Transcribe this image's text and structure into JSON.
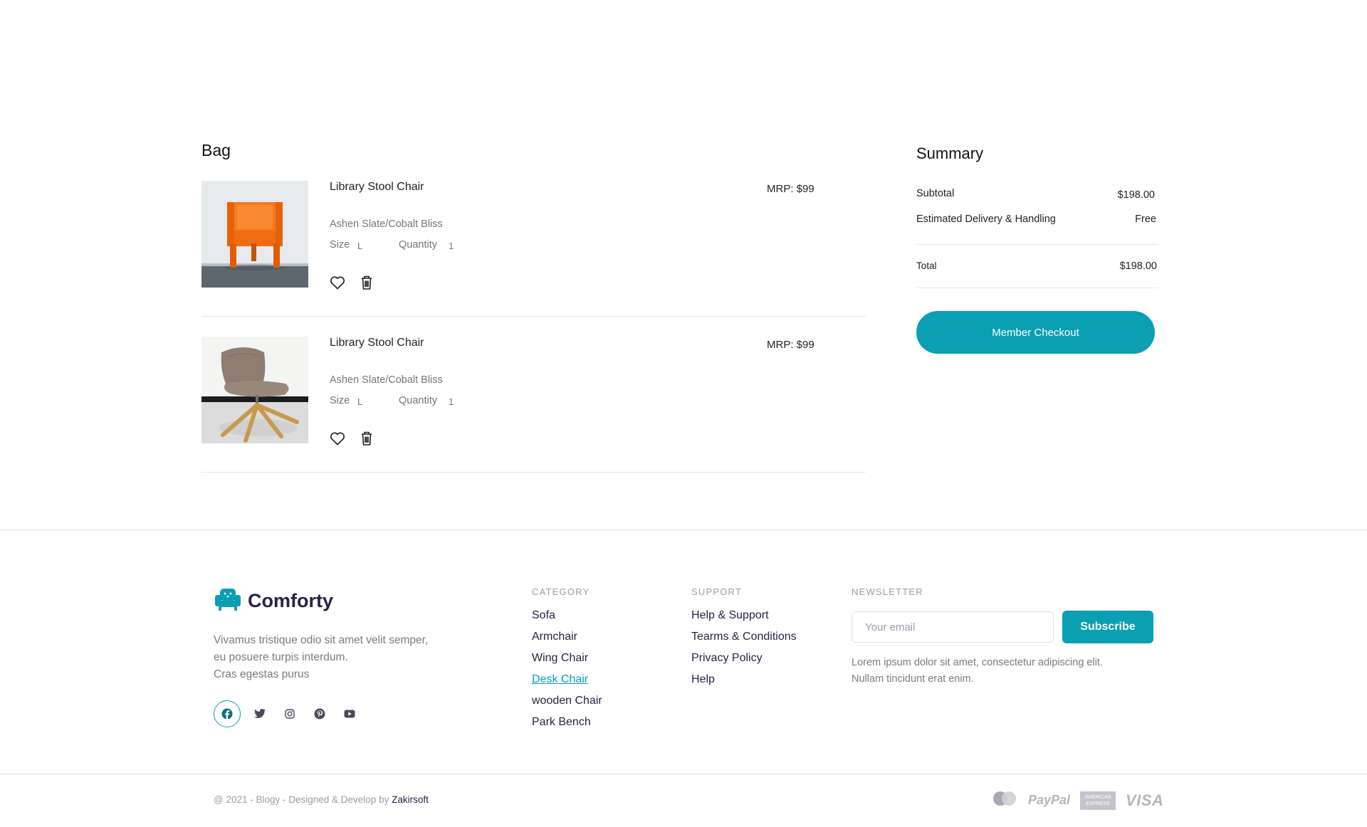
{
  "bag": {
    "title": "Bag",
    "items": [
      {
        "name": "Library Stool Chair",
        "price": "MRP: $99",
        "variant": "Ashen Slate/Cobalt Bliss",
        "size_label": "Size",
        "size": "L",
        "quantity_label": "Quantity",
        "quantity": "1",
        "image": "orange-chair"
      },
      {
        "name": "Library Stool Chair",
        "price": "MRP: $99",
        "variant": "Ashen Slate/Cobalt Bliss",
        "size_label": "Size",
        "size": "L",
        "quantity_label": "Quantity",
        "quantity": "1",
        "image": "beige-swivel-chair"
      }
    ],
    "icons": [
      "heart-icon",
      "trash-icon"
    ]
  },
  "summary": {
    "title": "Summary",
    "subtotal_label": "Subtotal",
    "subtotal": "$198.00",
    "delivery_label": "Estimated Delivery & Handling",
    "delivery": "Free",
    "total_label": "Total",
    "total": "$198.00",
    "checkout_label": "Member Checkout"
  },
  "footer": {
    "brand": "Comforty",
    "about": [
      "Vivamus tristique odio sit amet velit semper,",
      "eu posuere turpis interdum.",
      "Cras egestas purus"
    ],
    "social": [
      "facebook-icon",
      "twitter-icon",
      "instagram-icon",
      "pinterest-icon",
      "youtube-icon"
    ],
    "category": {
      "heading": "CATEGORY",
      "items": [
        "Sofa",
        "Armchair",
        "Wing Chair",
        "Desk Chair",
        "wooden Chair",
        "Park Bench"
      ],
      "active": "Desk Chair"
    },
    "support": {
      "heading": "SUPPORT",
      "items": [
        "Help & Support",
        "Tearms & Conditions",
        "Privacy Policy",
        "Help"
      ]
    },
    "newsletter": {
      "heading": "NEWSLETTER",
      "placeholder": "Your email",
      "button": "Subscribe",
      "text": [
        "Lorem ipsum dolor sit amet, consectetur adipiscing elit.",
        "Nullam tincidunt erat enim."
      ]
    },
    "copyright_prefix": "@ 2021 - Blogy - Designed & Develop by ",
    "copyright_brand": "Zakirsoft",
    "payments": {
      "paypal": "PayPal",
      "amex_line1": "AMERICAN",
      "amex_line2": "EXPRESS",
      "visa": "VISA"
    }
  },
  "colors": {
    "accent": "#0a9fb2",
    "text_dark": "#272343",
    "text_muted": "#7b7a85",
    "divider": "#e4e5e9"
  }
}
